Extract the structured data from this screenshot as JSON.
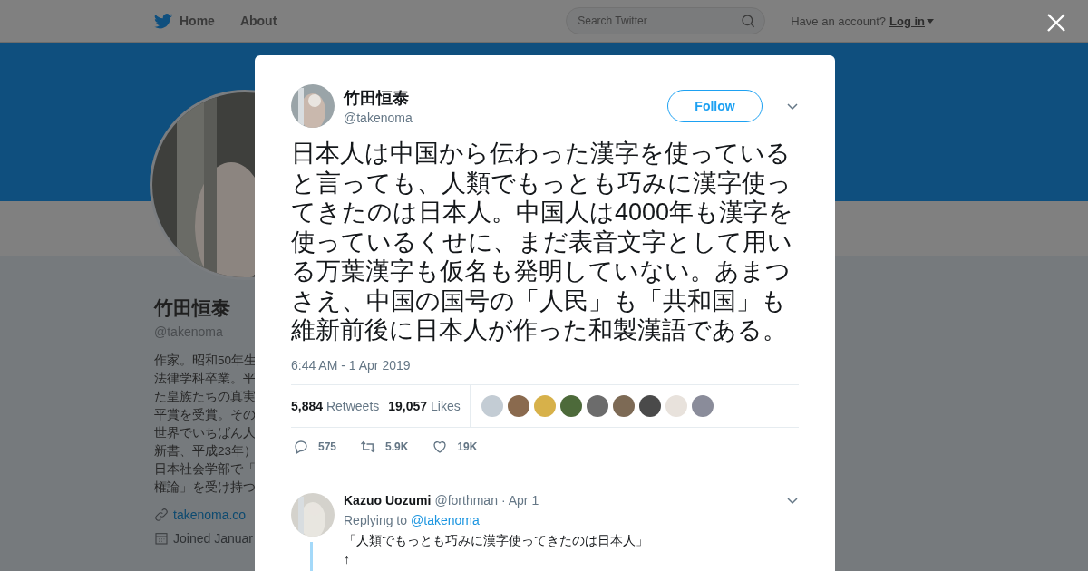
{
  "top_nav": {
    "items": [
      {
        "label": "Home",
        "kind": "logo"
      },
      {
        "label": "About",
        "kind": "plain"
      }
    ],
    "search": {
      "placeholder": "Search Twitter"
    },
    "account_prompt": "Have an account?",
    "login": "Log in"
  },
  "profile": {
    "name": "竹田恒泰",
    "handle": "@takenoma",
    "bio_lines": [
      "作家。昭和50年生",
      "法律学科卒業。平",
      "た皇族たちの真実",
      "平賞を受賞。その",
      "世界でいちばん人",
      "新書、平成23年）",
      "日本社会学部で「",
      "権論」を受け持つ"
    ],
    "link": "takenoma.co",
    "joined": "Joined Januar"
  },
  "tweet": {
    "author": "竹田恒泰",
    "handle": "@takenoma",
    "follow": "Follow",
    "text": "日本人は中国から伝わった漢字を使っていると言っても、人類でもっとも巧みに漢字使ってきたのは日本人。中国人は4000年も漢字を使っているくせに、まだ表音文字として用いる万葉漢字も仮名も発明していない。あまつさえ、中国の国号の「人民」も「共和国」も維新前後に日本人が作った和製漢語である。",
    "timestamp": "6:44 AM - 1 Apr 2019",
    "retweets": "5,884",
    "retweets_label": "Retweets",
    "likes": "19,057",
    "likes_label": "Likes",
    "liker_avatars": [
      {
        "color": "#c3ccd4"
      },
      {
        "color": "#8a6a4e"
      },
      {
        "color": "#d7b14a"
      },
      {
        "color": "#4d6a3a"
      },
      {
        "color": "#6c6c6c"
      },
      {
        "color": "#7d6a55"
      },
      {
        "color": "#4a4a4a"
      },
      {
        "color": "#e8e2dc"
      },
      {
        "color": "#8a8c9a"
      }
    ],
    "actions": [
      {
        "kind": "reply",
        "count": "575"
      },
      {
        "kind": "retweet",
        "count": "5.9K"
      },
      {
        "kind": "like",
        "count": "19K"
      }
    ]
  },
  "reply": {
    "name": "Kazuo Uozumi",
    "handle": "@forthman",
    "date": "· Apr 1",
    "replying_label": "Replying to",
    "replying_to": "@takenoma",
    "lines": [
      "「人類でもっとも巧みに漢字使ってきたのは日本人」",
      "↑"
    ]
  }
}
